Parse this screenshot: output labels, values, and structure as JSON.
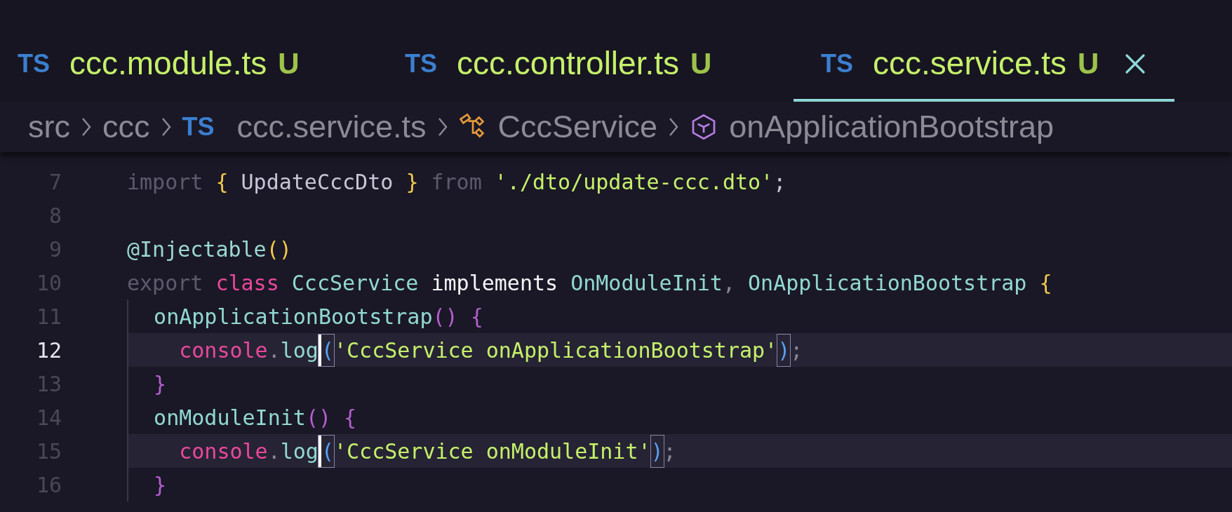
{
  "tabs": [
    {
      "icon_text": "TS",
      "label": "ccc.module.ts",
      "status": "U",
      "selected": false
    },
    {
      "icon_text": "TS",
      "label": "ccc.controller.ts",
      "status": "U",
      "selected": false
    },
    {
      "icon_text": "TS",
      "label": "ccc.service.ts",
      "status": "U",
      "selected": true
    }
  ],
  "breadcrumbs": [
    {
      "kind": "folder",
      "label": "src"
    },
    {
      "kind": "folder",
      "label": "ccc"
    },
    {
      "kind": "file",
      "icon_text": "TS",
      "label": "ccc.service.ts"
    },
    {
      "kind": "class",
      "label": "CccService"
    },
    {
      "kind": "method",
      "label": "onApplicationBootstrap"
    }
  ],
  "code_lines": [
    {
      "number": "7",
      "current": false,
      "highlighted": false,
      "in_block": false,
      "tokens": [
        {
          "kind": "keyword",
          "text": "import "
        },
        {
          "kind": "brace",
          "text": "{"
        },
        {
          "kind": "plain",
          "text": " UpdateCccDto "
        },
        {
          "kind": "brace",
          "text": "}"
        },
        {
          "kind": "keyword",
          "text": " from "
        },
        {
          "kind": "string",
          "text": "'./dto/update-ccc.dto'"
        },
        {
          "kind": "plain",
          "text": ";"
        }
      ]
    },
    {
      "number": "8",
      "current": false,
      "highlighted": false,
      "in_block": false
    },
    {
      "number": "9",
      "current": false,
      "highlighted": false,
      "in_block": false,
      "tokens": [
        {
          "kind": "decorator",
          "text": "@Injectable"
        },
        {
          "kind": "brace",
          "text": "()"
        }
      ]
    },
    {
      "number": "10",
      "current": false,
      "highlighted": false,
      "in_block": false,
      "tokens": [
        {
          "kind": "keyword",
          "text": "export "
        },
        {
          "kind": "storage",
          "text": "class"
        },
        {
          "kind": "type",
          "text": " CccService "
        },
        {
          "kind": "emphasis",
          "text": "implements"
        },
        {
          "kind": "type",
          "text": " OnModuleInit"
        },
        {
          "kind": "punct",
          "text": ", "
        },
        {
          "kind": "type",
          "text": "OnApplicationBootstrap "
        },
        {
          "kind": "brace",
          "text": "{"
        }
      ]
    },
    {
      "number": "11",
      "current": false,
      "highlighted": false,
      "in_block": true,
      "tokens": [
        {
          "kind": "type",
          "text": "  onApplicationBootstrap"
        },
        {
          "kind": "paren",
          "text": "() {"
        }
      ]
    },
    {
      "number": "12",
      "current": true,
      "highlighted": true,
      "in_block": true,
      "tokens": [
        {
          "kind": "storage",
          "text": "    console"
        },
        {
          "kind": "punct",
          "text": "."
        },
        {
          "kind": "type",
          "text": "log"
        },
        {
          "kind": "cursor-bracket",
          "text": "("
        },
        {
          "kind": "string",
          "text": "'CccService onApplicationBootstrap'"
        },
        {
          "kind": "match-bracket",
          "text": ")"
        },
        {
          "kind": "punct",
          "text": ";"
        }
      ]
    },
    {
      "number": "13",
      "current": false,
      "highlighted": false,
      "in_block": true,
      "tokens": [
        {
          "kind": "paren",
          "text": "  }"
        }
      ]
    },
    {
      "number": "14",
      "current": false,
      "highlighted": false,
      "in_block": true,
      "tokens": [
        {
          "kind": "type",
          "text": "  onModuleInit"
        },
        {
          "kind": "paren",
          "text": "() {"
        }
      ]
    },
    {
      "number": "15",
      "current": false,
      "highlighted": true,
      "in_block": true,
      "tokens": [
        {
          "kind": "storage",
          "text": "    console"
        },
        {
          "kind": "punct",
          "text": "."
        },
        {
          "kind": "type",
          "text": "log"
        },
        {
          "kind": "cursor-bracket",
          "text": "("
        },
        {
          "kind": "string",
          "text": "'CccService onModuleInit'"
        },
        {
          "kind": "match-bracket",
          "text": ")"
        },
        {
          "kind": "punct",
          "text": ";"
        }
      ]
    },
    {
      "number": "16",
      "current": false,
      "highlighted": false,
      "in_block": true,
      "tokens": [
        {
          "kind": "paren",
          "text": "  }"
        }
      ]
    }
  ]
}
